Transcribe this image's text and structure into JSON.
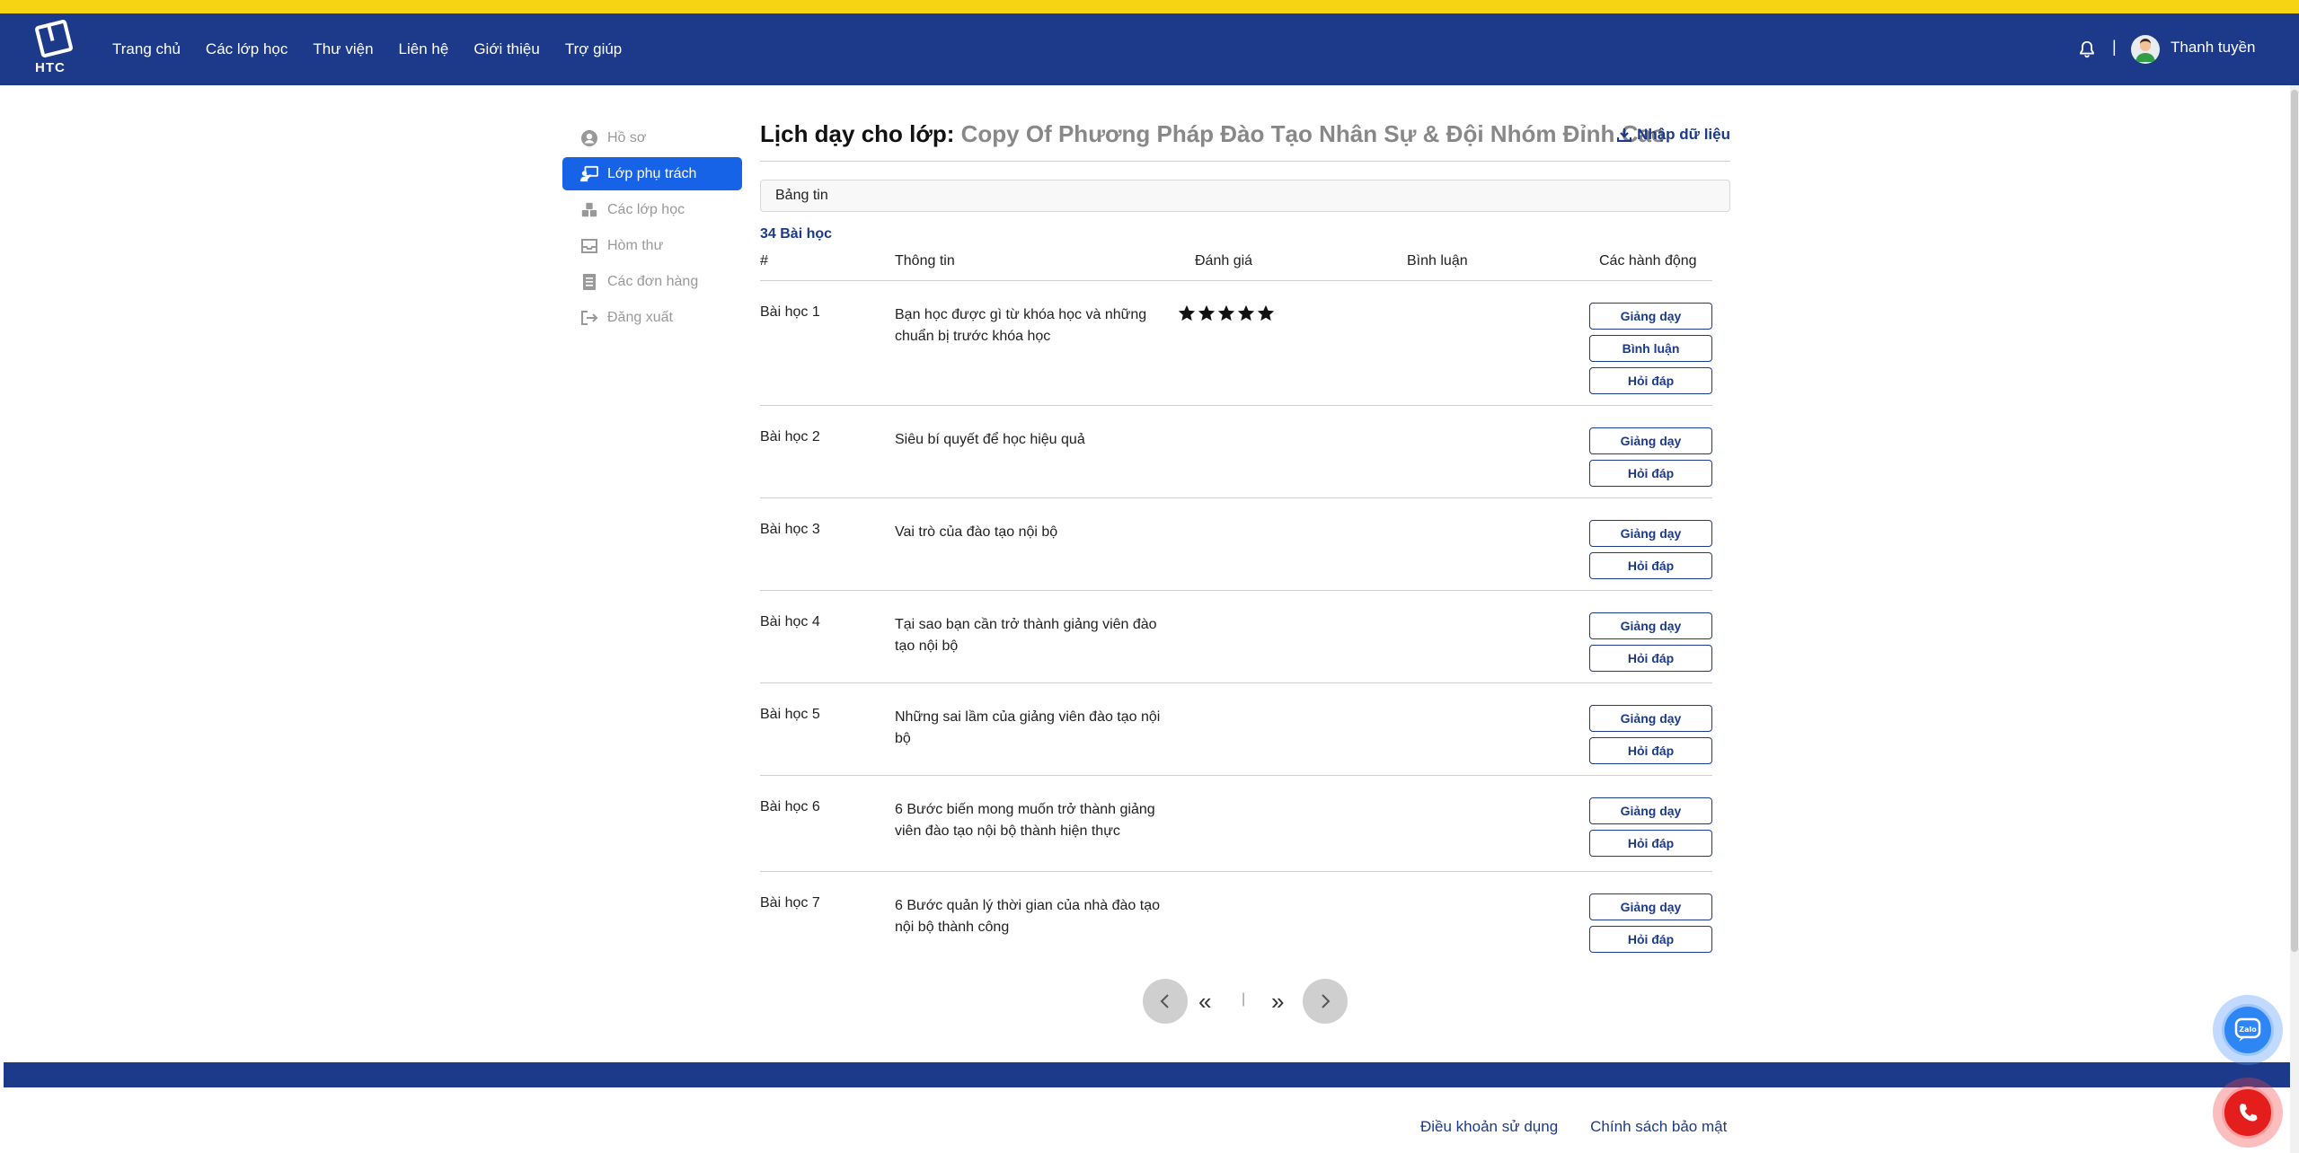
{
  "colors": {
    "navbar": "#1d3a8a",
    "top_stripe": "#f6d313",
    "active": "#1763e8",
    "accent": "#1d3a8a"
  },
  "brand": {
    "logo_text": "HTC"
  },
  "nav": {
    "items": [
      "Trang chủ",
      "Các lớp học",
      "Thư viện",
      "Liên hệ",
      "Giới thiệu",
      "Trợ giúp"
    ],
    "separator": "|",
    "user_name": "Thanh tuyền"
  },
  "sidebar": {
    "items": [
      {
        "label": "Hồ sơ",
        "icon": "user-circle-icon"
      },
      {
        "label": "Lớp phụ trách",
        "icon": "chalkboard-teacher-icon"
      },
      {
        "label": "Các lớp học",
        "icon": "cubes-icon"
      },
      {
        "label": "Hòm thư",
        "icon": "inbox-icon"
      },
      {
        "label": "Các đơn hàng",
        "icon": "receipt-icon"
      },
      {
        "label": "Đăng xuất",
        "icon": "sign-out-icon"
      }
    ]
  },
  "main": {
    "title_prefix": "Lịch dạy cho lớp:",
    "course_name": "Copy Of Phương Pháp Đào Tạo Nhân Sự & Đội Nhóm Đỉnh Cao",
    "import_label": "Nhập dữ liệu",
    "newsboard_label": "Bảng tin",
    "lesson_count": "34 Bài học"
  },
  "table": {
    "headers": {
      "num": "#",
      "info": "Thông tin",
      "rating": "Đánh giá",
      "comments": "Bình luận",
      "actions": "Các hành động"
    },
    "buttons": {
      "teach": "Giảng dạy",
      "comment": "Bình luận",
      "qa": "Hỏi đáp"
    },
    "rows": [
      {
        "num": "Bài học 1",
        "info": "Bạn học được gì từ khóa học và những chuẩn bị trước khóa học",
        "rating": 5
      },
      {
        "num": "Bài học 2",
        "info": "Siêu bí quyết để học hiệu quả",
        "rating": 0
      },
      {
        "num": "Bài học 3",
        "info": "Vai trò của đào tạo nội bộ",
        "rating": 0
      },
      {
        "num": "Bài học 4",
        "info": "Tại sao bạn cần trở thành giảng viên đào tạo nội bộ",
        "rating": 0
      },
      {
        "num": "Bài học 5",
        "info": "Những sai lầm của giảng viên đào tạo nội bộ",
        "rating": 0
      },
      {
        "num": "Bài học 6",
        "info": "6 Bước biến mong muốn trở thành giảng viên đào tạo nội bộ thành hiện thực",
        "rating": 0
      },
      {
        "num": "Bài học 7",
        "info": "6 Bước quản lý thời gian của nhà đào tạo nội bộ thành công",
        "rating": 0
      }
    ]
  },
  "pagination": {
    "first": "«",
    "last": "»",
    "separator": "|"
  },
  "footer": {
    "terms": "Điều khoản sử dụng",
    "privacy": "Chính sách bảo mật"
  },
  "floating": {
    "zalo_label": "Zalo"
  }
}
